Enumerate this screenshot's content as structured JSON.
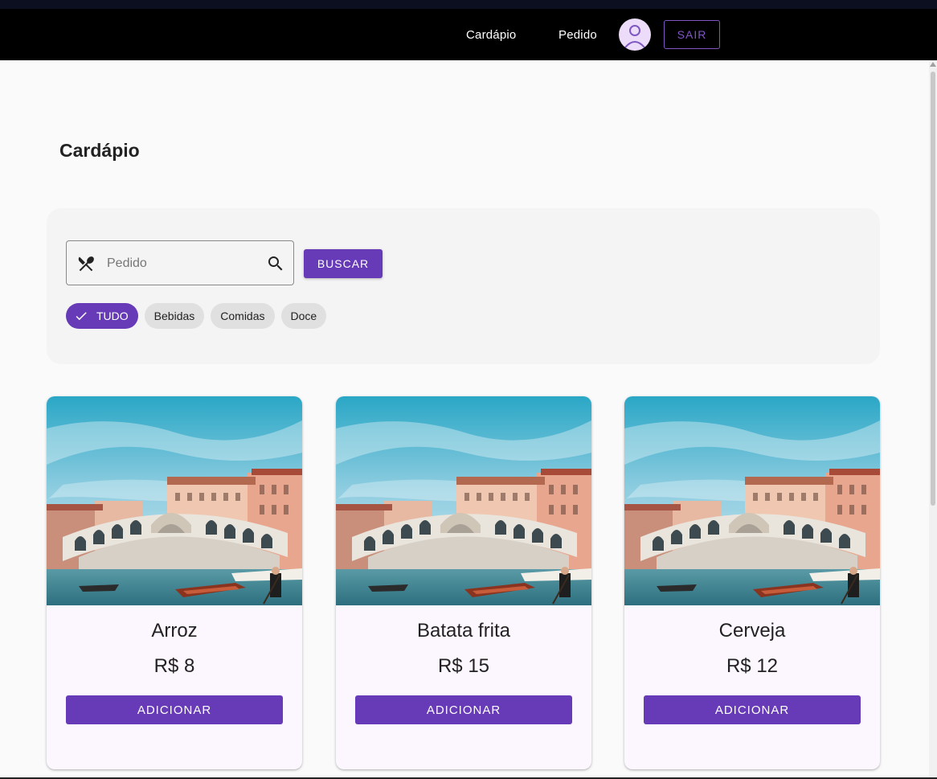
{
  "nav": {
    "links": [
      {
        "label": "Cardápio"
      },
      {
        "label": "Pedido"
      }
    ],
    "logout_label": "SAIR",
    "avatar_icon": "user-avatar-icon",
    "colors": {
      "bar": "#000000",
      "accent": "#7e57c2"
    }
  },
  "page": {
    "title": "Cardápio"
  },
  "filters": {
    "search": {
      "placeholder": "Pedido",
      "value": "",
      "leading_icon": "utensils-icon",
      "trailing_icon": "search-icon"
    },
    "search_button_label": "BUSCAR",
    "chips": [
      {
        "label": "TUDO",
        "selected": true,
        "icon": "check-icon"
      },
      {
        "label": "Bebidas",
        "selected": false
      },
      {
        "label": "Comidas",
        "selected": false
      },
      {
        "label": "Doce",
        "selected": false
      }
    ]
  },
  "products": [
    {
      "name": "Arroz",
      "price": "R$ 8",
      "button_label": "ADICIONAR"
    },
    {
      "name": "Batata frita",
      "price": "R$ 15",
      "button_label": "ADICIONAR"
    },
    {
      "name": "Cerveja",
      "price": "R$ 12",
      "button_label": "ADICIONAR"
    }
  ],
  "colors": {
    "primary": "#673ab7",
    "card_bg": "#fcf6fe",
    "page_bg": "#fafafa",
    "panel_bg": "#f4f4f4"
  }
}
